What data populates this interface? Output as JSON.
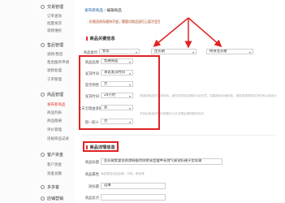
{
  "sidebar": {
    "groups": [
      {
        "title": "交易管理",
        "icon": "circle-icon",
        "items": [
          "订单查询",
          "批量发货",
          "退款维权"
        ]
      },
      {
        "title": "售后管理",
        "icon": "circle-icon",
        "items": [
          "退款/售后",
          "售后服务申请",
          "退款处理",
          "工单管理"
        ]
      },
      {
        "title": "商品管理",
        "icon": "circle-icon",
        "items": [
          "发布新商品",
          "商品列表",
          "商品图册",
          "评价管理",
          "违规商品记录"
        ],
        "active_item": "发布新商品"
      },
      {
        "title": "客户资金",
        "icon": "circle-icon",
        "items": [
          "客户资金",
          "资金总额"
        ]
      },
      {
        "title": "多多客",
        "icon": "circle-icon",
        "items": []
      },
      {
        "title": "店铺营销",
        "icon": "circle-icon",
        "items": []
      }
    ]
  },
  "breadcrumb": {
    "parent": "发布新商品",
    "separator": "/",
    "current": "编辑商品"
  },
  "notice": "价格及库存维持不变，需要对商品进行上架才会生效",
  "sections": {
    "basic": {
      "title": "商品关键信息"
    },
    "detail": {
      "title": "商品详情信息"
    }
  },
  "category_row": {
    "label": "商品类目",
    "selects": [
      "女装",
      "连衣裙",
      "修身连衣裙"
    ]
  },
  "fields": [
    {
      "label": "商品品牌",
      "value": "普通商品"
    },
    {
      "label": "发货时间",
      "value": "承诺发货时间"
    },
    {
      "label": "是否预售",
      "value": "否"
    },
    {
      "label": "发货时间",
      "value": "24小时"
    },
    {
      "label": "七天无理由退换",
      "value": "是"
    },
    {
      "label": "假一赔十",
      "value": "否"
    }
  ],
  "notes": [
    "请选择商品的发货时间，超时发货将会受到平台处罚，如果商品价格较低，请选择更短的发货时间以免扣分",
    "开启后商品详情页将展示七天无理由退换服务标识"
  ],
  "detail_fields": [
    {
      "label": "商品标题",
      "value": "连衣裙女夏装新款韩版时尚修身显瘦中长款气质雪纺裙子女装潮"
    },
    {
      "label": "商品属性",
      "value": "商品属性包括品牌、尺码、颜色等"
    },
    {
      "label": "短标题",
      "value": "选填"
    },
    {
      "label": "商品卖点",
      "value": ""
    }
  ],
  "colors": {
    "accent": "#e1342a",
    "annotation": "#e02323",
    "link": "#1b5fa8"
  }
}
